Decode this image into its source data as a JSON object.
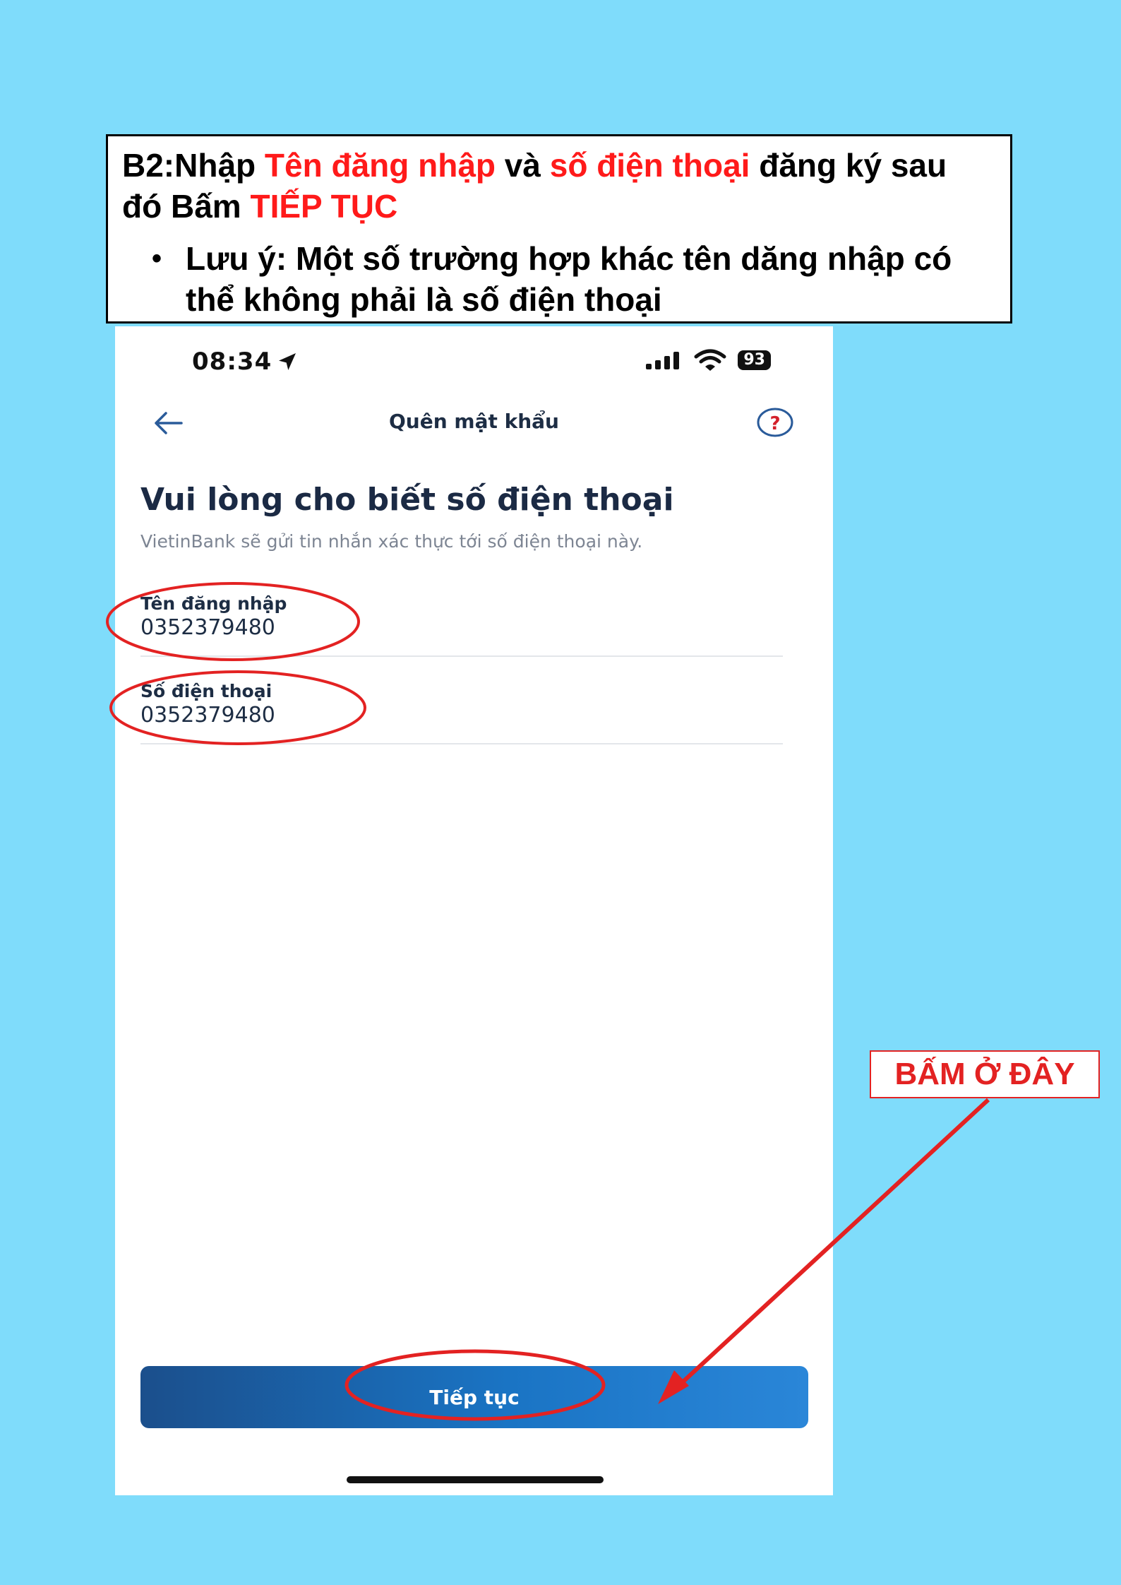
{
  "instruction": {
    "line1_prefix": "B2:Nhập ",
    "highlight_username": "Tên đăng nhập",
    "line1_and": " và ",
    "highlight_phone": "số điện thoại",
    "line1_suffix": " đăng ký sau",
    "line2_prefix": "đó Bấm ",
    "highlight_continue": "TIẾP TỤC",
    "note_bullet": "•",
    "note": "Lưu ý: Một số trường hợp khác tên dăng nhập có thể không phải là số điện thoại"
  },
  "status_bar": {
    "time": "08:34",
    "battery": "93"
  },
  "nav": {
    "title": "Quên mật khẩu"
  },
  "form": {
    "heading": "Vui lòng cho biết số điện thoại",
    "subheading": "VietinBank sẽ gửi tin nhắn xác thực tới số điện thoại này.",
    "username_label": "Tên đăng nhập",
    "username_value": "0352379480",
    "phone_label": "Số điện thoại",
    "phone_value": "0352379480"
  },
  "button": {
    "continue_label": "Tiếp tục"
  },
  "callout": {
    "label": "BẤM Ở ĐÂY"
  },
  "colors": {
    "page_background": "#7fdcfb",
    "annotation_red": "#e32222",
    "button_blue": "#1a74c4",
    "text_dark": "#1d2d44"
  },
  "icons": [
    "location-arrow-icon",
    "signal-icon",
    "wifi-icon",
    "battery-icon",
    "back-arrow-icon",
    "help-icon"
  ]
}
